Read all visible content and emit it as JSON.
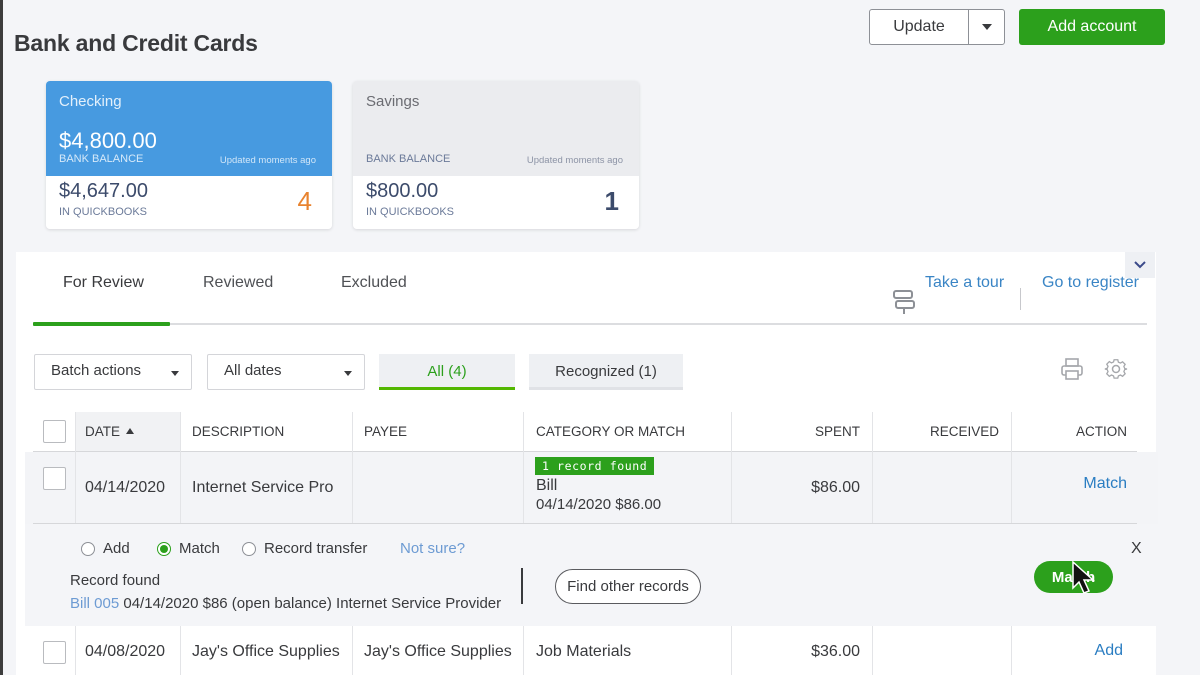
{
  "page": {
    "title": "Bank and Credit Cards"
  },
  "header": {
    "update_label": "Update",
    "add_account_label": "Add account"
  },
  "accounts": [
    {
      "name": "Checking",
      "bank_balance": "$4,800.00",
      "bank_balance_label": "BANK BALANCE",
      "updated": "Updated moments ago",
      "quickbooks_balance": "$4,647.00",
      "quickbooks_label": "IN QUICKBOOKS",
      "pending_count": "4",
      "selected": true
    },
    {
      "name": "Savings",
      "bank_balance": "",
      "bank_balance_label": "BANK BALANCE",
      "updated": "Updated moments ago",
      "quickbooks_balance": "$800.00",
      "quickbooks_label": "IN QUICKBOOKS",
      "pending_count": "1",
      "selected": false
    }
  ],
  "tabs": [
    {
      "label": "For Review",
      "active": true
    },
    {
      "label": "Reviewed",
      "active": false
    },
    {
      "label": "Excluded",
      "active": false
    }
  ],
  "links": {
    "take_tour": "Take a tour",
    "go_to_register": "Go to register"
  },
  "filters": {
    "batch_actions": "Batch actions",
    "date_range": "All dates",
    "all": "All (4)",
    "recognized": "Recognized (1)"
  },
  "table": {
    "columns": [
      "DATE",
      "DESCRIPTION",
      "PAYEE",
      "CATEGORY OR MATCH",
      "SPENT",
      "RECEIVED",
      "ACTION"
    ],
    "sort_column": "DATE",
    "sort_direction": "ascending",
    "rows": [
      {
        "date": "04/14/2020",
        "description": "Internet Service Pro",
        "payee": "",
        "badge": "1 record found",
        "category": "Bill",
        "category_detail": "04/14/2020 $86.00",
        "spent": "$86.00",
        "received": "",
        "action": "Match",
        "expanded": true
      },
      {
        "date": "04/08/2020",
        "description": "Jay's Office Supplies",
        "payee": "Jay's Office Supplies",
        "badge": "",
        "category": "Job Materials",
        "category_detail": "",
        "spent": "$36.00",
        "received": "",
        "action": "Add",
        "expanded": false
      }
    ]
  },
  "expanded_panel": {
    "options": [
      {
        "label": "Add",
        "checked": false
      },
      {
        "label": "Match",
        "checked": true
      },
      {
        "label": "Record transfer",
        "checked": false
      }
    ],
    "not_sure": "Not sure?",
    "record_found_label": "Record found",
    "record_link": "Bill 005",
    "record_detail": " 04/14/2020 $86 (open balance) Internet Service Provider",
    "find_other_label": "Find other records",
    "match_button_label": "Match",
    "close_label": "X"
  },
  "colors": {
    "brand_green": "#2ca01c",
    "selected_card_blue": "#479ae0",
    "link_blue": "#2a7dc2",
    "pending_orange": "#e8832f"
  }
}
